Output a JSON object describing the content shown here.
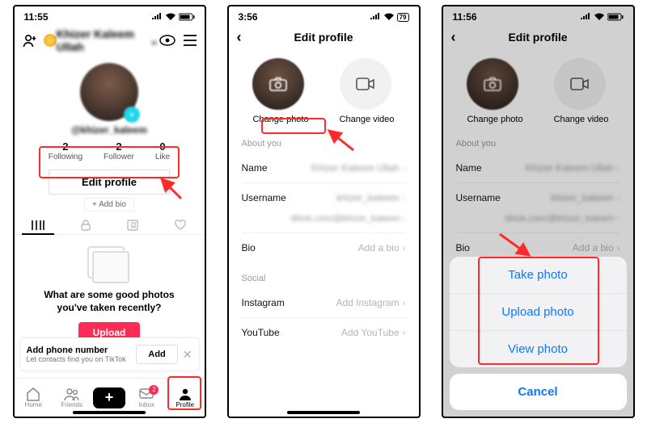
{
  "s1": {
    "time": "11:55",
    "name_top": "Khizer Kaleem Ullah",
    "handle": "@khizer_kaleem",
    "stats": {
      "following_n": "2",
      "following_l": "Following",
      "follower_n": "2",
      "follower_l": "Follower",
      "like_n": "0",
      "like_l": "Like"
    },
    "edit": "Edit profile",
    "addbio": "+ Add bio",
    "promo": {
      "line1": "What are some good photos",
      "line2": "you've taken recently?",
      "upload": "Upload"
    },
    "phonecard": {
      "title": "Add phone number",
      "sub": "Let contacts find you on TikTok",
      "add": "Add"
    },
    "nav": {
      "home": "Home",
      "friends": "Friends",
      "inbox": "Inbox",
      "inbox_badge": "2",
      "profile": "Profile"
    }
  },
  "s2": {
    "time": "3:56",
    "title": "Edit profile",
    "change_photo": "Change photo",
    "change_video": "Change video",
    "about": "About you",
    "name_l": "Name",
    "name_v": "Khizer Kaleem Ullah",
    "user_l": "Username",
    "user_v": "khizer_kaleem",
    "link": "tiktok.com/@khizer_kaleem",
    "bio_l": "Bio",
    "bio_v": "Add a bio",
    "social": "Social",
    "ig_l": "Instagram",
    "ig_v": "Add Instagram",
    "yt_l": "YouTube",
    "yt_v": "Add YouTube"
  },
  "s3": {
    "time": "11:56",
    "title": "Edit profile",
    "change_photo": "Change photo",
    "change_video": "Change video",
    "about": "About you",
    "name_l": "Name",
    "name_v": "Khizer Kaleem Ullah",
    "user_l": "Username",
    "user_v": "khizer_kaleem",
    "link": "tiktok.com/@khizer_kaleem",
    "bio_l": "Bio",
    "bio_v": "Add a bio",
    "sheet": {
      "take": "Take photo",
      "upload": "Upload photo",
      "view": "View photo",
      "cancel": "Cancel"
    }
  }
}
